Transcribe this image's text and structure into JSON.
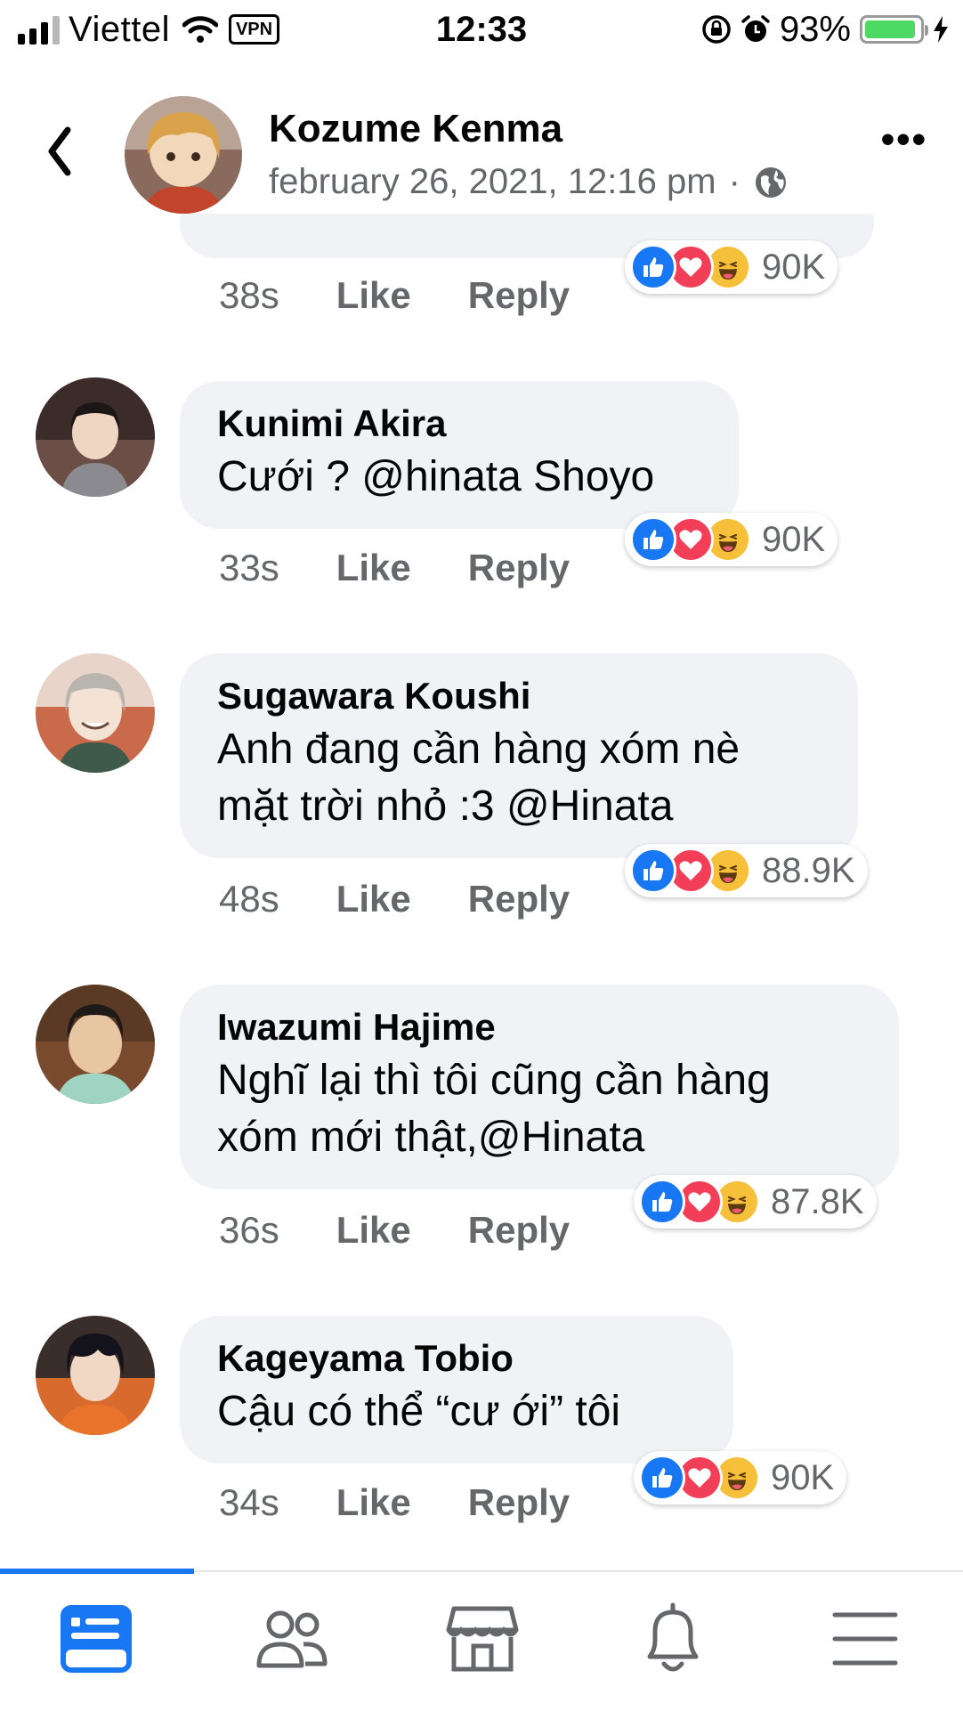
{
  "status_bar": {
    "carrier": "Viettel",
    "vpn": "VPN",
    "time": "12:33",
    "battery": "93%",
    "battery_level": 0.93
  },
  "header": {
    "name": "Kozume Kenma",
    "date": "february 26, 2021, 12:16 pm",
    "separator": "·",
    "more": "•••",
    "icons": [
      "back-chevron-icon",
      "globe-icon",
      "more-options-icon"
    ]
  },
  "comments": [
    {
      "name": "",
      "text": [],
      "time": "38s",
      "like": "Like",
      "reply": "Reply",
      "reactions": "90K"
    },
    {
      "name": "Kunimi Akira",
      "text": [
        "Cưới ? @hinata Shoyo"
      ],
      "time": "33s",
      "like": "Like",
      "reply": "Reply",
      "reactions": "90K"
    },
    {
      "name": "Sugawara Koushi",
      "text": [
        "Anh đang cần hàng xóm nè",
        "mặt trời nhỏ :3 @Hinata"
      ],
      "time": "48s",
      "like": "Like",
      "reply": "Reply",
      "reactions": "88.9K"
    },
    {
      "name": "Iwazumi Hajime",
      "text": [
        "Nghĩ lại thì tôi cũng cần hàng",
        "xóm mới thật,@Hinata"
      ],
      "time": "36s",
      "like": "Like",
      "reply": "Reply",
      "reactions": "87.8K"
    },
    {
      "name": "Kageyama Tobio",
      "text": [
        "Cậu có thể “cư ới” tôi"
      ],
      "time": "34s",
      "like": "Like",
      "reply": "Reply",
      "reactions": "90K"
    }
  ],
  "reaction_types": [
    "like-icon",
    "love-icon",
    "haha-icon"
  ],
  "bottom_nav": {
    "items": [
      "news-feed-icon",
      "friends-icon",
      "marketplace-icon",
      "notifications-icon",
      "menu-icon"
    ],
    "active": "news-feed-icon"
  },
  "colors": {
    "accent": "#1877f2",
    "bubble": "#f0f2f5",
    "secondary_text": "#65676b",
    "love": "#f33e58",
    "haha": "#f7c03a",
    "battery": "#4cd964"
  }
}
